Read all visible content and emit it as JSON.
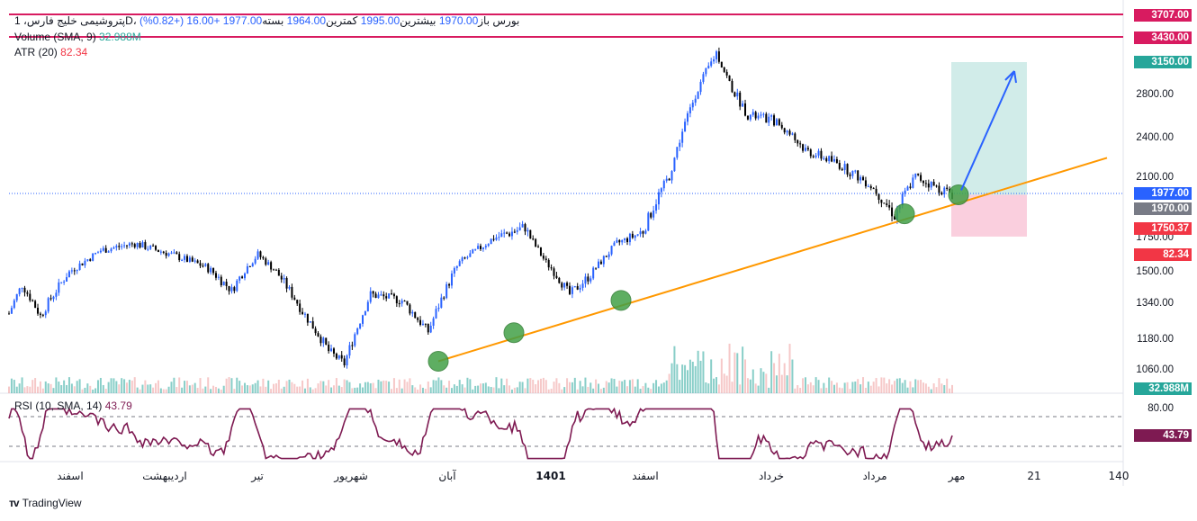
{
  "legend": {
    "symbol": "پتروشیمی خلیج فارس، 1D، بورس",
    "open_label": "باز",
    "open": "1970.00",
    "high_label": "بیشترین",
    "high": "1995.00",
    "low_label": "کمترین",
    "low": "1964.00",
    "close_label": "بسته",
    "close": "1977.00",
    "change": "+16.00 (+0.82%)",
    "volume_label": "Volume (SMA, 9)",
    "volume_value": "32.988M",
    "atr_label": "ATR (20)",
    "atr_value": "82.34",
    "rsi_label": "RSI (10, SMA, 14)",
    "rsi_value": "43.79"
  },
  "tags": {
    "r1": "3707.00",
    "r2": "3430.00",
    "target": "3150.00",
    "close": "1977.00",
    "entry": "1970.00",
    "stop": "1750.37",
    "atr": "82.34",
    "volume": "32.988M",
    "rsi": "43.79"
  },
  "colors": {
    "up": "#2962ff",
    "down": "#000000",
    "resistance": "#d81b60",
    "trendline": "#ff9800",
    "arrow": "#2962ff",
    "marker_fill": "#43a047",
    "target_zone": "#b2dfdb",
    "stop_zone": "#f8bbd0",
    "rsi_line": "#7e1a52",
    "vol_up": "#26a69a",
    "vol_down": "#ef9a9a",
    "atr_tag": "#f23645",
    "vol_tag": "#26a69a"
  },
  "chart_data": [
    {
      "type": "candlestick",
      "title": "پتروشیمی خلیج فارس، 1D، بورس",
      "y_ticks": [
        1060,
        1180,
        1340,
        1500,
        1750,
        2100,
        2400,
        2800
      ],
      "y_tick_labels": [
        "1060.00",
        "1180.00",
        "1340.00",
        "1500.00",
        "1750.00",
        "2100.00",
        "2400.00",
        "2800.00"
      ],
      "x_tick_labels": [
        "اسفند",
        "اردیبهشت",
        "تیر",
        "شهریور",
        "آبان",
        "1401",
        "اسفند",
        "خرداد",
        "مرداد",
        "مهر",
        "21",
        "140"
      ],
      "close_path": [
        {
          "x": 0,
          "y": 1290
        },
        {
          "x": 5,
          "y": 1430
        },
        {
          "x": 12,
          "y": 1280
        },
        {
          "x": 22,
          "y": 1480
        },
        {
          "x": 35,
          "y": 1650
        },
        {
          "x": 48,
          "y": 1700
        },
        {
          "x": 62,
          "y": 1620
        },
        {
          "x": 75,
          "y": 1530
        },
        {
          "x": 85,
          "y": 1400
        },
        {
          "x": 95,
          "y": 1620
        },
        {
          "x": 104,
          "y": 1460
        },
        {
          "x": 112,
          "y": 1300
        },
        {
          "x": 122,
          "y": 1130
        },
        {
          "x": 128,
          "y": 1080
        },
        {
          "x": 138,
          "y": 1380
        },
        {
          "x": 150,
          "y": 1350
        },
        {
          "x": 160,
          "y": 1210
        },
        {
          "x": 172,
          "y": 1560
        },
        {
          "x": 185,
          "y": 1740
        },
        {
          "x": 197,
          "y": 1800
        },
        {
          "x": 205,
          "y": 1560
        },
        {
          "x": 214,
          "y": 1380
        },
        {
          "x": 222,
          "y": 1480
        },
        {
          "x": 232,
          "y": 1700
        },
        {
          "x": 242,
          "y": 1780
        },
        {
          "x": 252,
          "y": 2100
        },
        {
          "x": 262,
          "y": 2800
        },
        {
          "x": 270,
          "y": 3260
        },
        {
          "x": 276,
          "y": 2850
        },
        {
          "x": 282,
          "y": 2600
        },
        {
          "x": 292,
          "y": 2550
        },
        {
          "x": 304,
          "y": 2300
        },
        {
          "x": 316,
          "y": 2200
        },
        {
          "x": 328,
          "y": 2050
        },
        {
          "x": 338,
          "y": 1860
        },
        {
          "x": 346,
          "y": 2100
        },
        {
          "x": 354,
          "y": 2020
        },
        {
          "x": 360,
          "y": 1977
        }
      ],
      "entry": 1970,
      "target": 3150,
      "stop": 1750.37,
      "resistance_levels": [
        3707,
        3430
      ],
      "volume_sma_value": "32.988M",
      "atr_value": 82.34
    },
    {
      "type": "line",
      "title": "RSI (10, SMA, 14)",
      "y_ticks": [
        80
      ],
      "y_tick_labels": [
        "80.00"
      ],
      "levels": [
        70,
        30
      ],
      "last_value": 43.79
    }
  ]
}
